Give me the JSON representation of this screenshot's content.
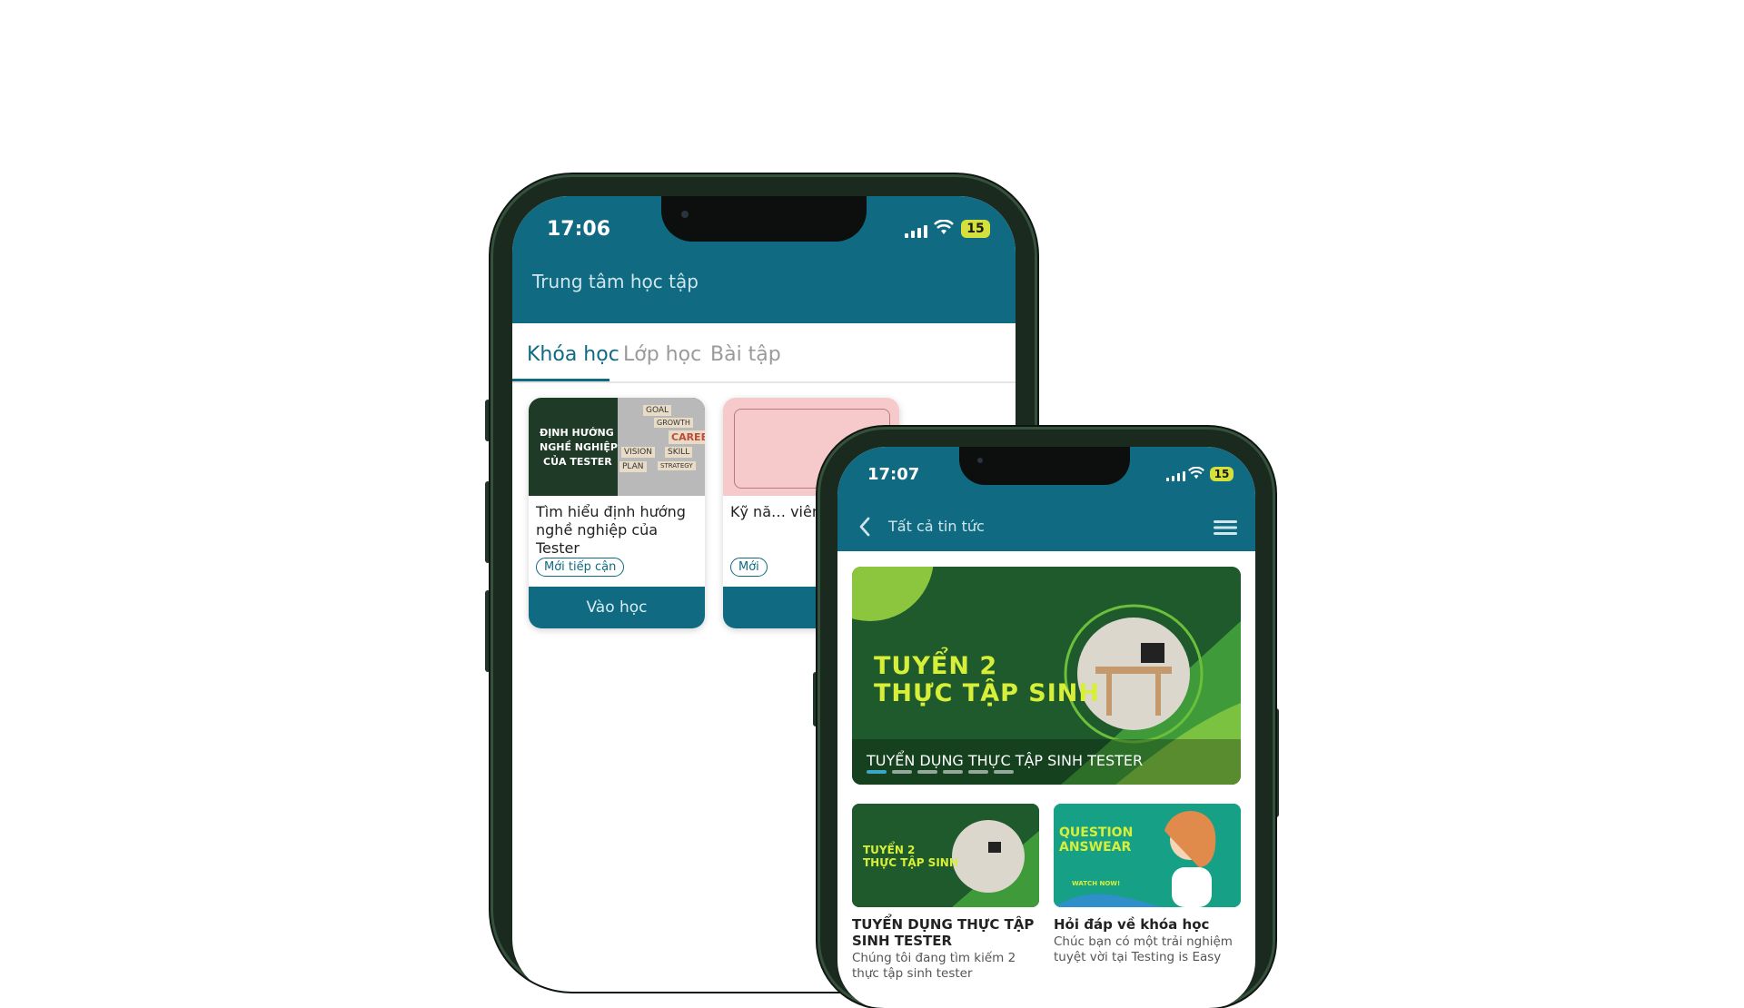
{
  "phone_back": {
    "status": {
      "time": "17:06",
      "battery": "15"
    },
    "header": {
      "title": "Trung tâm học tập"
    },
    "tabs": [
      {
        "label": "Khóa học",
        "active": true
      },
      {
        "label": "Lớp học",
        "active": false
      },
      {
        "label": "Bài tập",
        "active": false
      }
    ],
    "courses": [
      {
        "thumb_text": [
          "ĐỊNH HƯỚNG",
          "NGHỀ NGHIỆP",
          "CỦA TESTER"
        ],
        "thumb_words": [
          "GOAL",
          "GROWTH",
          "CAREE",
          "SKILL",
          "VISION",
          "PLAN",
          "STRATEGY"
        ],
        "title": "Tìm hiểu định hướng nghề nghiệp của Tester",
        "tag": "Mới tiếp cận",
        "button": "Vào học"
      },
      {
        "title": "Kỹ nă… viên",
        "tag": "Mới",
        "button": ""
      }
    ]
  },
  "phone_front": {
    "status": {
      "time": "17:07",
      "battery": "15"
    },
    "header": {
      "title": "Tất cả tin tức"
    },
    "hero": {
      "title_lines": [
        "TUYỂN 2",
        "THỰC TẬP SINH"
      ],
      "caption": "TUYỂN DỤNG THỰC TẬP SINH TESTER"
    },
    "news": [
      {
        "thumb_lines": [
          "TUYỂN 2",
          "THỰC TẬP SINH"
        ],
        "title": "TUYỂN DỤNG THỰC TẬP SINH TESTER",
        "desc": "Chúng tôi đang tìm kiếm 2 thực tập sinh tester"
      },
      {
        "thumb_lines": [
          "QUESTION",
          "ANSWEAR"
        ],
        "thumb_sub": "WATCH NOW!",
        "title": "Hỏi đáp về khóa học",
        "desc": "Chúc bạn có một trải nghiệm tuyệt vời tại Testing is Easy"
      }
    ]
  },
  "colors": {
    "primary": "#0f6a82",
    "accent": "#d8ef3a",
    "frame": "#1b2a1f"
  }
}
